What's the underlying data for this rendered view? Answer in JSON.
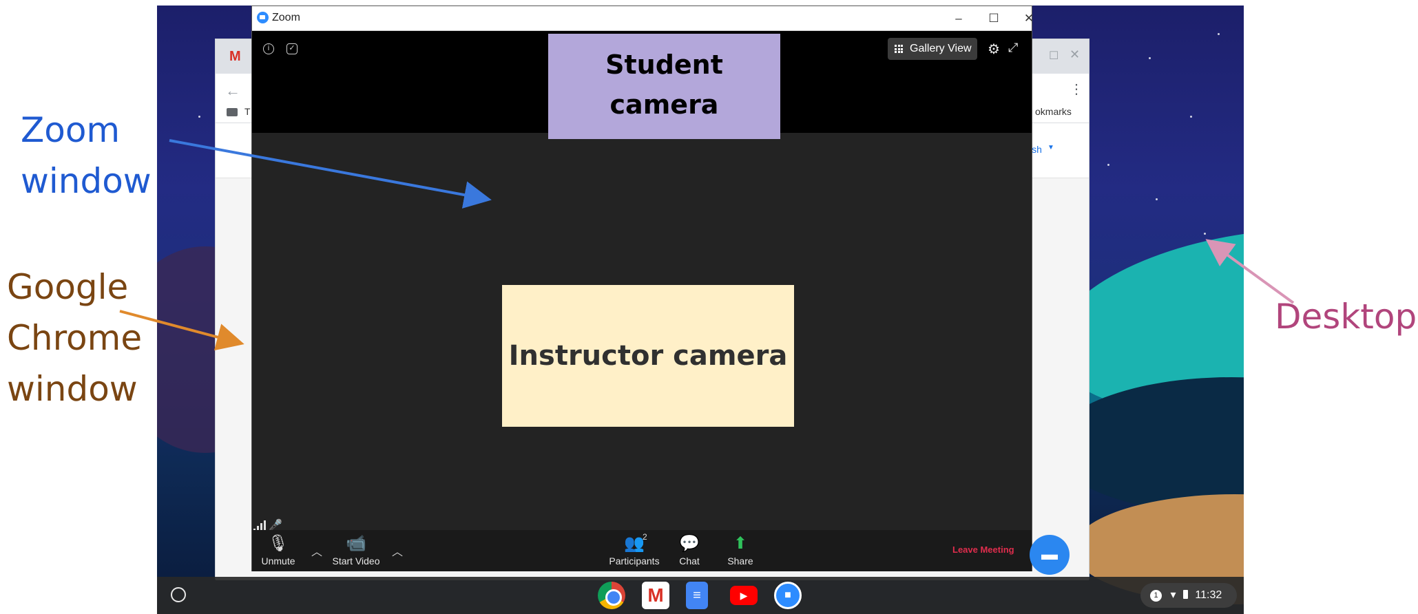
{
  "annotations": {
    "zoom_window": "Zoom\nwindow",
    "chrome_window": "Google\nChrome\nwindow",
    "desktop": "Desktop"
  },
  "zoom": {
    "title": "Zoom",
    "window_controls": {
      "minimize": "–",
      "maximize": "☐",
      "close": "✕"
    },
    "view_button": "Gallery View",
    "student_camera": "Student camera",
    "instructor_camera": "Instructor camera",
    "toolbar": {
      "unmute": "Unmute",
      "start_video": "Start Video",
      "participants": "Participants",
      "participants_count": "2",
      "chat": "Chat",
      "share": "Share",
      "leave": "Leave Meeting"
    }
  },
  "chrome": {
    "bookmarks_partial": "okmarks",
    "folder_partial": "T",
    "page_partial": "ish"
  },
  "shelf": {
    "apps": [
      "chrome-icon",
      "gmail-icon",
      "docs-icon",
      "youtube-icon",
      "zoom-icon"
    ],
    "tray_badge": "1",
    "time": "11:32"
  },
  "colors": {
    "zoom_label": "#1f5ad1",
    "chrome_label": "#7a4512",
    "desktop_label": "#b1457c",
    "student_cam": "#b3a7da",
    "instructor_cam": "#fff0c8",
    "leave": "#e02d4d"
  }
}
